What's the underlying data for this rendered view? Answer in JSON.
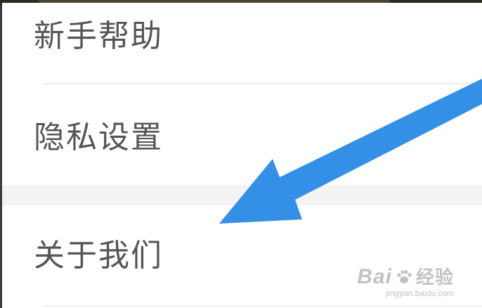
{
  "menu": {
    "items": [
      {
        "label": "新手帮助"
      },
      {
        "label": "隐私设置"
      },
      {
        "label": "关于我们"
      }
    ]
  },
  "annotation": {
    "arrow_color": "#3390e6"
  },
  "watermark": {
    "brand_a": "Bai",
    "brand_b": "经验",
    "url": "jingyan.baidu.com"
  },
  "colors": {
    "label": "#555555",
    "divider": "#eeeeee",
    "section_gap": "#f3f3f3"
  }
}
